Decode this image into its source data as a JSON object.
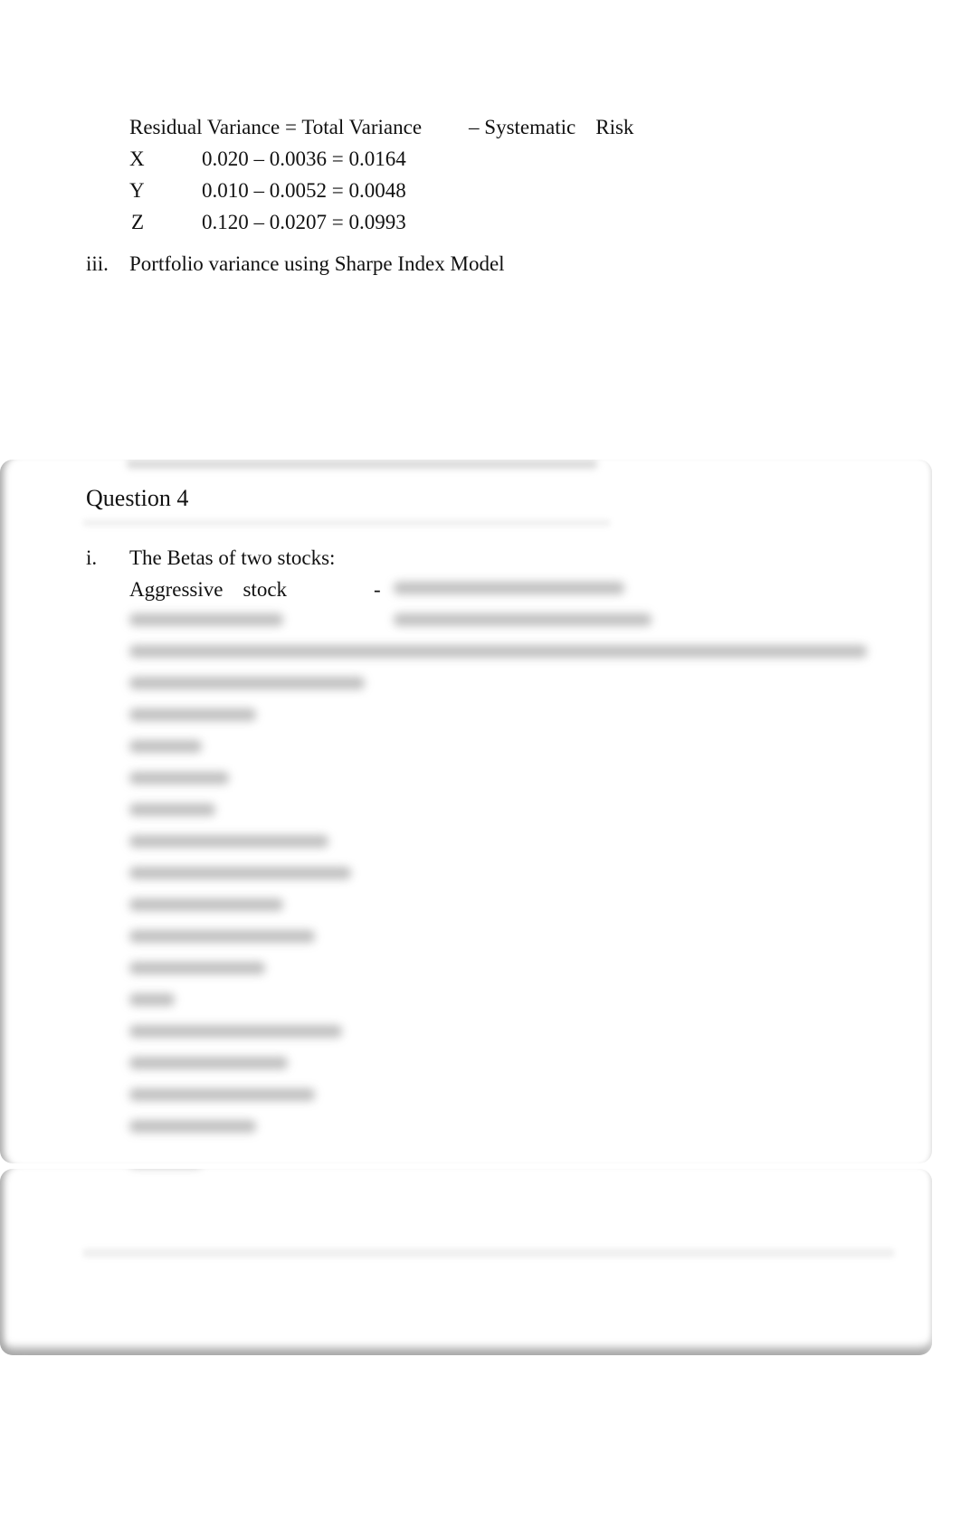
{
  "document": {
    "formula_header": {
      "left": "Residual Variance = Total Variance",
      "middle": "– Systematic",
      "right": "Risk"
    },
    "variance_rows": [
      {
        "label": "X",
        "equation": "0.020 – 0.0036 = 0.0164"
      },
      {
        "label": "Y",
        "equation": "0.010 – 0.0052 = 0.0048"
      },
      {
        "label": "Z",
        "equation": "0.120 – 0.0207 = 0.0993"
      }
    ],
    "item_iii": {
      "numeral": "iii.",
      "text": "Portfolio variance using Sharpe Index Model"
    }
  },
  "locked_card": {
    "question_title": "Question 4",
    "item_i": {
      "numeral": "i.",
      "text": "The Betas of two stocks:"
    },
    "aggressive_row": {
      "label_1": "Aggressive",
      "label_2": "stock",
      "separator": "-"
    },
    "blurred_content_note": "remaining answer text is blurred / not legible"
  }
}
